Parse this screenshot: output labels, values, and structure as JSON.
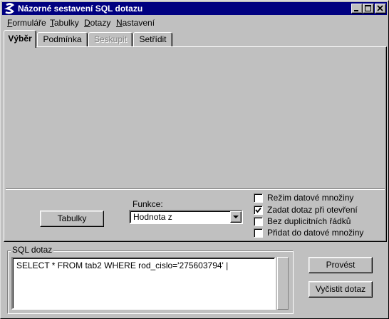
{
  "window": {
    "title": "Názorné sestavení SQL dotazu",
    "colors": {
      "titlebar": "#000080",
      "face": "#c0c0c0",
      "text_disabled": "#808080"
    }
  },
  "menu": [
    {
      "label": "Formuláře",
      "mnemonic": "F"
    },
    {
      "label": "Tabulky",
      "mnemonic": "T"
    },
    {
      "label": "Dotazy",
      "mnemonic": "D"
    },
    {
      "label": "Nastavení",
      "mnemonic": "N"
    }
  ],
  "tabs": [
    {
      "label": "Výběr",
      "state": "active"
    },
    {
      "label": "Podmínka",
      "state": "normal"
    },
    {
      "label": "Seskupit",
      "state": "disabled"
    },
    {
      "label": "Setřídit",
      "state": "normal"
    }
  ],
  "panel": {
    "tables_button": "Tabulky",
    "function_label": "Funkce:",
    "function_value": "Hodnota z",
    "options": [
      {
        "label": "Režim datové množiny",
        "checked": false
      },
      {
        "label": "Zadat dotaz při otevření",
        "checked": true
      },
      {
        "label": "Bez duplicitních řádků",
        "checked": false
      },
      {
        "label": "Přidat do datové množiny",
        "checked": false
      }
    ]
  },
  "sql": {
    "group_label": "SQL dotaz",
    "query": "SELECT * FROM tab2 WHERE rod_cislo='275603794' |"
  },
  "actions": {
    "execute": "Provést",
    "clear": "Vyčistit dotaz"
  }
}
